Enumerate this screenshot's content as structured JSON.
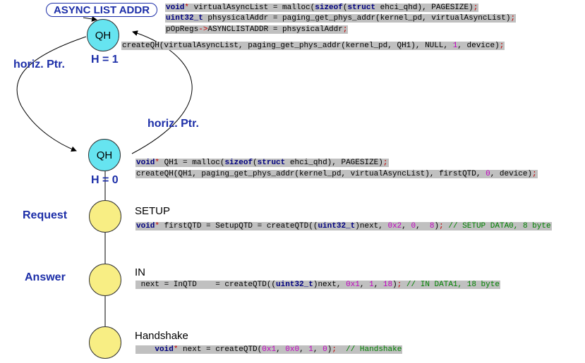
{
  "async_list_addr_label": "ASYNC LIST ADDR",
  "qh_label": "QH",
  "qh1_height_label": "H = 1",
  "qh0_height_label": "H = 0",
  "horiz_ptr_left": "horiz. Ptr.",
  "horiz_ptr_right": "horiz. Ptr.",
  "request_label": "Request",
  "answer_label": "Answer",
  "stage_setup": "SETUP",
  "stage_in": "IN",
  "stage_handshake": "Handshake",
  "colors": {
    "qh_fill": "#66e4f0",
    "qtd_fill": "#f8ee84",
    "label_blue": "#1c2ea8",
    "code_bg": "#c0c0c0",
    "keyword": "#000080",
    "symbol": "#c00000",
    "number": "#c000c0",
    "comment": "#008000"
  },
  "code": {
    "async1": {
      "kw1": "void",
      "sym1": "*",
      "t1": " virtualAsyncList = malloc(",
      "kw2": "sizeof",
      "t2": "(",
      "kw3": "struct",
      "t3": " ehci_qhd), PAGESIZE)",
      "sym2": ";"
    },
    "async2": {
      "kw1": "uint32_t",
      "t1": " phsysicalAddr = paging_get_phys_addr(kernel_pd, virtualAsyncList)",
      "sym1": ";"
    },
    "async3": {
      "t1": "pOpRegs",
      "sym1": "->",
      "t2": "ASYNCLISTADDR = phsysicalAddr",
      "sym2": ";"
    },
    "async4": {
      "t1": "createQH(virtualAsyncList, paging_get_phys_addr(kernel_pd, QH1), NULL, ",
      "num1": "1",
      "t2": ", device)",
      "sym1": ";"
    },
    "qh0a": {
      "kw1": "void",
      "sym1": "*",
      "t1": " QH1 = malloc(",
      "kw2": "sizeof",
      "t2": "(",
      "kw3": "struct",
      "t3": " ehci_qhd), PAGESIZE)",
      "sym2": ";"
    },
    "qh0b": {
      "t1": "createQH(QH1, paging_get_phys_addr(kernel_pd, virtualAsyncList), firstQTD, ",
      "num1": "0",
      "t2": ", device)",
      "sym1": ";"
    },
    "setup": {
      "kw1": "void",
      "sym1": "*",
      "t1": " firstQTD = SetupQTD = createQTD((",
      "kw2": "uint32_t",
      "t2": ")next, ",
      "num1": "0x2",
      "t3": ", ",
      "num2": "0",
      "t4": ",  ",
      "num3": "8",
      "t5": ")",
      "sym2": ";",
      "cmt": " // SETUP DATA0, 8 byte"
    },
    "in": {
      "t1": " next = InQTD    = createQTD((",
      "kw1": "uint32_t",
      "t2": ")next, ",
      "num1": "0x1",
      "t3": ", ",
      "num2": "1",
      "t4": ", ",
      "num3": "18",
      "t5": ")",
      "sym1": ";",
      "cmt": " // IN DATA1, 18 byte"
    },
    "handshake": {
      "t0": "    ",
      "kw1": "void",
      "sym1": "*",
      "t1": " next = createQTD(",
      "num1": "0x1",
      "t2": ", ",
      "num2": "0x0",
      "t3": ", ",
      "num3": "1",
      "t4": ", ",
      "num4": "0",
      "t5": ")",
      "sym2": ";",
      "cmt": "  // Handshake"
    }
  }
}
